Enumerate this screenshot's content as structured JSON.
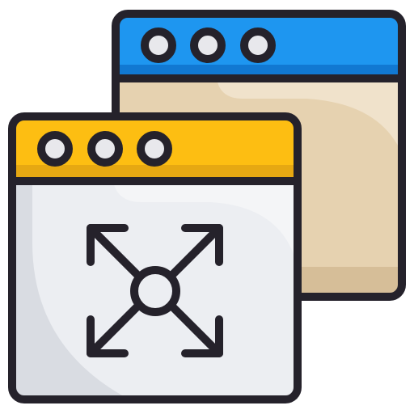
{
  "colors": {
    "outline": "#25222B",
    "back_header": "#1E96F0",
    "back_header_shade": "#1178D2",
    "back_body": "#E6D2B0",
    "back_body_highlight": "#F0E2CB",
    "back_body_shade": "#D6BE98",
    "front_header": "#FDBE12",
    "front_header_shade": "#E6A812",
    "front_body": "#D9DCE2",
    "front_body_highlight": "#ECEEF2",
    "dot_fill": "#E8E8EC"
  },
  "icons": {
    "main": "expand-windows-icon",
    "center_symbol": "move-arrows-icon"
  }
}
